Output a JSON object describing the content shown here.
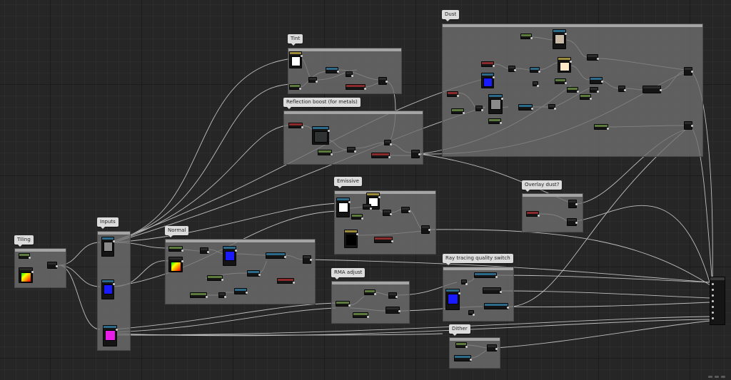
{
  "comments": {
    "tint": "Tint",
    "reflection_boost": "Reflection boost (for metals)",
    "dust": "Dust",
    "emissive": "Emissive",
    "overlay_dust": "Overlay dust?",
    "tiling": "Tiling",
    "inputs": "Inputs",
    "normal": "Normal",
    "rma_adjust": "RMA adjust",
    "ray_tracing_quality_switch": "Ray tracing quality switch",
    "dither": "Dither"
  },
  "colors": {
    "grid_bg": "#262626",
    "comment_fill": "#707070",
    "wire": "#d8d8d8",
    "node_body": "#141414",
    "scalar_header": "#5c7a3c",
    "constant_header": "#8a2a2a",
    "texture_header": "#2c6a8a",
    "swatch_white": "#ffffff",
    "swatch_blue": "#1a1aff",
    "swatch_magenta": "#e81ee8",
    "swatch_gray": "#8a8a8a",
    "swatch_beige": "#c8bca8",
    "swatch_cream": "#fde8c8",
    "swatch_black": "#000000"
  },
  "icons": {
    "output": "material-output-icon",
    "nav": "graph-navigation-icon"
  }
}
